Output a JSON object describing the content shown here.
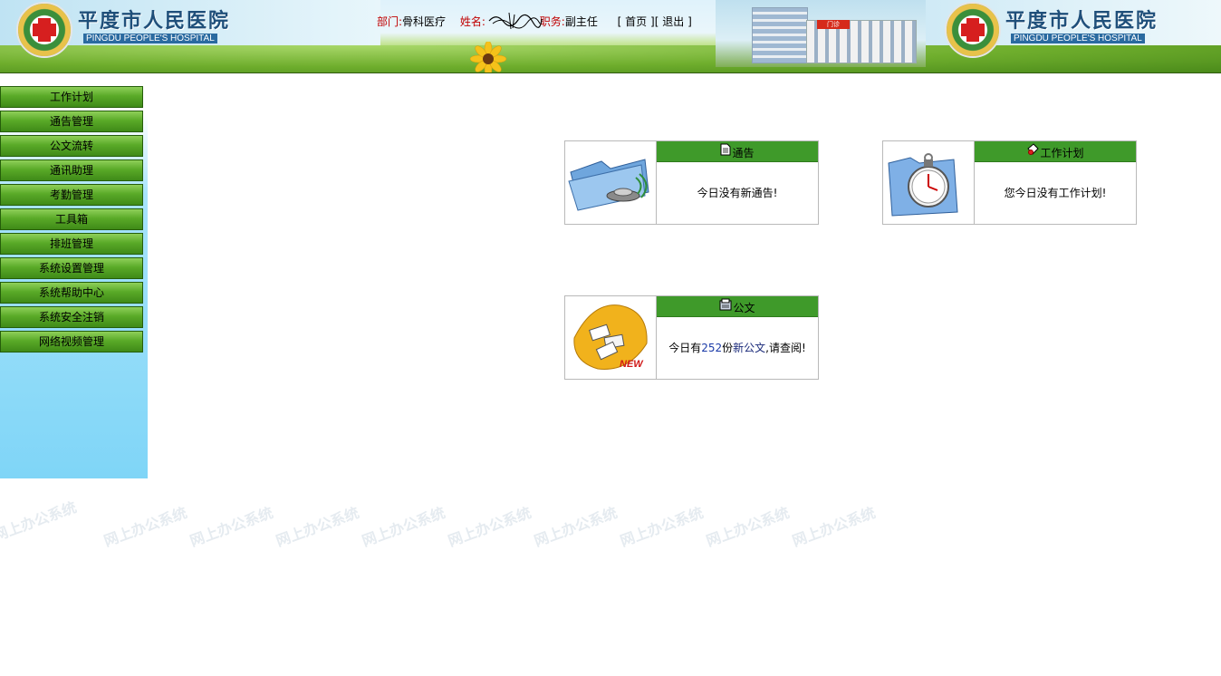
{
  "header": {
    "hospital_name_cn": "平度市人民医院",
    "hospital_name_en": "PINGDU PEOPLE'S HOSPITAL",
    "user_info": {
      "dept_label": "部门:",
      "dept_value": "骨科医疗",
      "name_label": "姓名:",
      "position_label": "职务:",
      "position_value": "副主任"
    },
    "nav": {
      "open_bracket": "[",
      "home": "首页",
      "separator": "][",
      "logout": "退出",
      "close_bracket": "]"
    },
    "building_sign": "门诊"
  },
  "sidebar": {
    "items": [
      {
        "label": "工作计划"
      },
      {
        "label": "通告管理"
      },
      {
        "label": "公文流转"
      },
      {
        "label": "通讯助理"
      },
      {
        "label": "考勤管理"
      },
      {
        "label": "工具箱"
      },
      {
        "label": "排班管理"
      },
      {
        "label": "系统设置管理"
      },
      {
        "label": "系统帮助中心"
      },
      {
        "label": "系统安全注销"
      },
      {
        "label": "网络视频管理"
      }
    ]
  },
  "watermark": {
    "text": "网上办公系统"
  },
  "cards": {
    "notice": {
      "title": "通告",
      "message": "今日没有新通告!"
    },
    "plan": {
      "title": "工作计划",
      "message": "您今日没有工作计划!"
    },
    "document": {
      "title": "公文",
      "message_prefix": "今日有",
      "count": "252",
      "message_mid": "份",
      "link_text": "新公文",
      "message_suffix": ",请查阅!",
      "badge": "NEW"
    }
  },
  "colors": {
    "menu_green": "#5aaa28",
    "card_header_green": "#3f9a2a",
    "label_red": "#c00000",
    "sidebar_blue": "#7fd5f7"
  }
}
